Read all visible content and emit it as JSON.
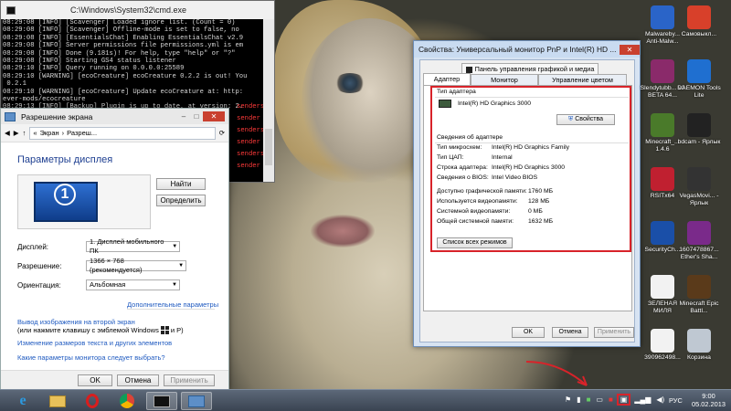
{
  "cmd": {
    "title": "C:\\Windows\\System32\\cmd.exe",
    "lines": [
      "08:29:08 [INFO] [Scavenger] Loaded ignore list. (Count = 0)",
      "08:29:08 [INFO] [Scavenger] Offline-mode is set to false, no",
      "08:29:08 [INFO] [EssentialsChat] Enabling EssentialsChat v2.9",
      "08:29:08 [INFO] Server permissions file permissions.yml is em",
      "08:29:08 [INFO] Done (9.181s)! For help, type \"help\" or \"?\"",
      "08:29:08 [INFO] Starting GS4 status listener",
      "08:29:10 [INFO] Query running on 0.0.0.0:25589",
      "08:29:10 [WARNING] [ecoCreature] ecoCreature 0.2.2 is out! You",
      " 0.2.1",
      "08:29:10 [WARNING] [ecoCreature] Update ecoCreature at: http:",
      "ever-mods/ecocreature",
      "08:29:13 [INFO] [Backup] Plugin is up to date, at version: 2.",
      "1"
    ],
    "red_fragments": [
      "senders",
      "sender",
      "senders",
      "sender",
      "senders",
      "sender"
    ]
  },
  "resolution": {
    "title": "Разрешение экрана",
    "address": [
      "«",
      "Экран",
      "›",
      "Разреш..."
    ],
    "heading": "Параметры дисплея",
    "monitor_number": "1",
    "find_button": "Найти",
    "identify_button": "Определить",
    "display_label": "Дисплей:",
    "display_value": "1. Дисплей мобильного ПК",
    "resolution_label": "Разрешение:",
    "resolution_value": "1366 × 768 (рекомендуется)",
    "orientation_label": "Ориентация:",
    "orientation_value": "Альбомная",
    "advanced_link": "Дополнительные параметры",
    "project_link": "Вывод изображения на второй экран",
    "project_hint": "(или нажмите клавишу с эмблемой Windows",
    "project_hint_end": "и P)",
    "text_size_link": "Изменение размеров текста и других элементов",
    "which_settings_link": "Какие параметры монитора следует выбрать?",
    "ok": "OK",
    "cancel": "Отмена",
    "apply": "Применить"
  },
  "properties": {
    "title": "Свойства: Универсальный монитор PnP и Intel(R) HD ...",
    "top_tab": "Панель управления графикой и медиа Intel(R)",
    "tabs": [
      "Адаптер",
      "Монитор",
      "Управление цветом"
    ],
    "adapter_type_label": "Тип адаптера",
    "adapter_name": "Intel(R) HD Graphics 3000",
    "properties_button": "Свойства",
    "info_heading": "Сведения об адаптере",
    "info": [
      {
        "k": "Тип микросхем:",
        "v": "Intel(R) HD Graphics Family"
      },
      {
        "k": "Тип ЦАП:",
        "v": "Internal"
      },
      {
        "k": "Строка адаптера:",
        "v": "Intel(R) HD Graphics 3000"
      },
      {
        "k": "Сведения о BIOS:",
        "v": "Intel Video BIOS"
      }
    ],
    "memory": [
      {
        "k": "Доступно графической памяти:",
        "v": "1760 МБ"
      },
      {
        "k": "Используется видеопамяти:",
        "v": "128 МБ"
      },
      {
        "k": "Системной видеопамяти:",
        "v": "0 МБ"
      },
      {
        "k": "Общей системной памяти:",
        "v": "1632 МБ"
      }
    ],
    "list_modes_button": "Список всех режимов",
    "ok": "OK",
    "cancel": "Отмена",
    "apply": "Применить"
  },
  "desktop_icons": [
    {
      "label": "Malwareby... Anti-Malw...",
      "color": "#2a64c8"
    },
    {
      "label": "Самовыкл...",
      "color": "#d8402a"
    },
    {
      "label": "Slendytubb... v2 BETA 64...",
      "color": "#8a2a6a"
    },
    {
      "label": "DAEMON Tools Lite",
      "color": "#1f6fd0"
    },
    {
      "label": "Minecraft_... 1.4.6",
      "color": "#4a7a2a"
    },
    {
      "label": "bdcam - Ярлык",
      "color": "#222222"
    },
    {
      "label": "RSITx64",
      "color": "#c02030"
    },
    {
      "label": "VegasMovi... - Ярлык",
      "color": "#333333"
    },
    {
      "label": "SecurityCh...",
      "color": "#1a4fa8"
    },
    {
      "label": "1607478867... Ether's Sha...",
      "color": "#7a2a8a"
    },
    {
      "label": "ЗЕЛЕНАЯ МИЛЯ",
      "color": "#f2f2f2"
    },
    {
      "label": "Minecraft Epic Battl...",
      "color": "#5a3a1a"
    },
    {
      "label": "390962498...",
      "color": "#f2f2f2"
    },
    {
      "label": "Корзина",
      "color": "#bfc8d2"
    }
  ],
  "taskbar": {
    "apps": [
      "ie-icon",
      "explorer-icon",
      "opera-icon",
      "chrome-icon",
      "cmd-icon",
      "display-settings-icon"
    ],
    "lang": "РУС",
    "time": "9:00",
    "date": "05.02.2013"
  }
}
